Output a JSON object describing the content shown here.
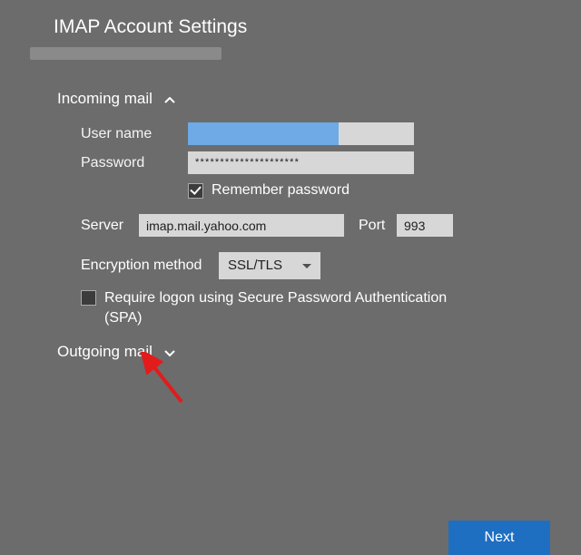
{
  "title": "IMAP Account Settings",
  "sections": {
    "incoming": {
      "header": "Incoming mail",
      "expanded": true,
      "fields": {
        "username_label": "User name",
        "username_value": "",
        "password_label": "Password",
        "password_mask": "*********************",
        "remember_label": "Remember password",
        "remember_checked": true,
        "server_label": "Server",
        "server_value": "imap.mail.yahoo.com",
        "port_label": "Port",
        "port_value": "993",
        "encryption_label": "Encryption method",
        "encryption_value": "SSL/TLS",
        "spa_checked": false,
        "spa_label": "Require logon using Secure Password Authentication (SPA)"
      }
    },
    "outgoing": {
      "header": "Outgoing mail",
      "expanded": false
    }
  },
  "buttons": {
    "next": "Next"
  }
}
